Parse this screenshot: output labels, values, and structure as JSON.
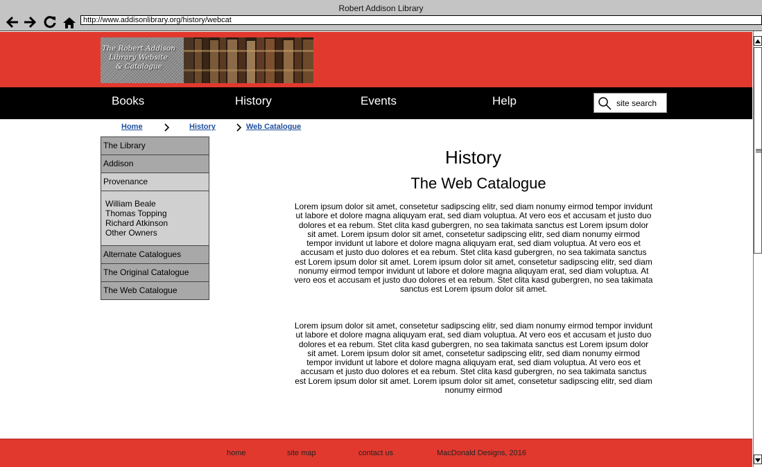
{
  "browser": {
    "window_title": "Robert Addison Library",
    "url": "http://www.addisonlibrary.org/history/webcat",
    "icons": [
      "back-arrow-icon",
      "forward-arrow-icon",
      "reload-icon",
      "home-icon"
    ]
  },
  "header": {
    "logo_text": "The Robert Addison\n   Library Website\n      & Catalogue"
  },
  "nav": {
    "books": "Books",
    "history": "History",
    "events": "Events",
    "help": "Help",
    "search_placeholder": "site search"
  },
  "breadcrumb": {
    "home": "Home",
    "history": "History",
    "current": "Web Catalogue"
  },
  "sidebar": {
    "items": [
      {
        "label": "The Library"
      },
      {
        "label": "Addison"
      },
      {
        "label": "Provenance"
      },
      {
        "label": "Alternate Catalogues"
      },
      {
        "label": "The Original Catalogue"
      },
      {
        "label": "The Web Catalogue"
      }
    ],
    "provenance_sub": [
      {
        "label": "William Beale"
      },
      {
        "label": "Thomas Topping"
      },
      {
        "label": "Richard Atkinson"
      },
      {
        "label": "Other Owners"
      }
    ]
  },
  "content": {
    "title": "History",
    "subtitle": "The Web Catalogue",
    "paragraphs": [
      "Lorem ipsum dolor sit amet, consetetur sadipscing elitr, sed diam nonumy eirmod tempor invidunt ut labore et dolore magna aliquyam erat, sed diam voluptua. At vero eos et accusam et justo duo dolores et ea rebum. Stet clita kasd gubergren, no sea takimata sanctus est Lorem ipsum dolor sit amet. Lorem ipsum dolor sit amet, consetetur sadipscing elitr, sed diam nonumy eirmod tempor invidunt ut labore et dolore magna aliquyam erat, sed diam voluptua. At vero eos et accusam et justo duo dolores et ea rebum. Stet clita kasd gubergren, no sea takimata sanctus est Lorem ipsum dolor sit amet. Lorem ipsum dolor sit amet, consetetur sadipscing elitr, sed diam nonumy eirmod tempor invidunt ut labore et dolore magna aliquyam erat, sed diam voluptua. At vero eos et accusam et justo duo dolores et ea rebum. Stet clita kasd gubergren, no sea takimata sanctus est Lorem ipsum dolor sit amet.",
      "Lorem ipsum dolor sit amet, consetetur sadipscing elitr, sed diam nonumy eirmod tempor invidunt ut labore et dolore magna aliquyam erat, sed diam voluptua. At vero eos et accusam et justo duo dolores et ea rebum. Stet clita kasd gubergren, no sea takimata sanctus est Lorem ipsum dolor sit amet. Lorem ipsum dolor sit amet, consetetur sadipscing elitr, sed diam nonumy eirmod tempor invidunt ut labore et dolore magna aliquyam erat, sed diam voluptua. At vero eos et accusam et justo duo dolores et ea rebum. Stet clita kasd gubergren, no sea takimata sanctus est Lorem ipsum dolor sit amet. Lorem ipsum dolor sit amet, consetetur sadipscing elitr, sed diam nonumy eirmod"
    ]
  },
  "footer": {
    "home": "home",
    "site_map": "site map",
    "contact": "contact us",
    "copyright": "MacDonald Designs, 2016"
  },
  "colors": {
    "brand_red": "#e2392f",
    "nav_black": "#000000",
    "link_blue": "#1f4f9e",
    "menu_dark": "#a8a8a8",
    "menu_light": "#d0d0d0"
  }
}
